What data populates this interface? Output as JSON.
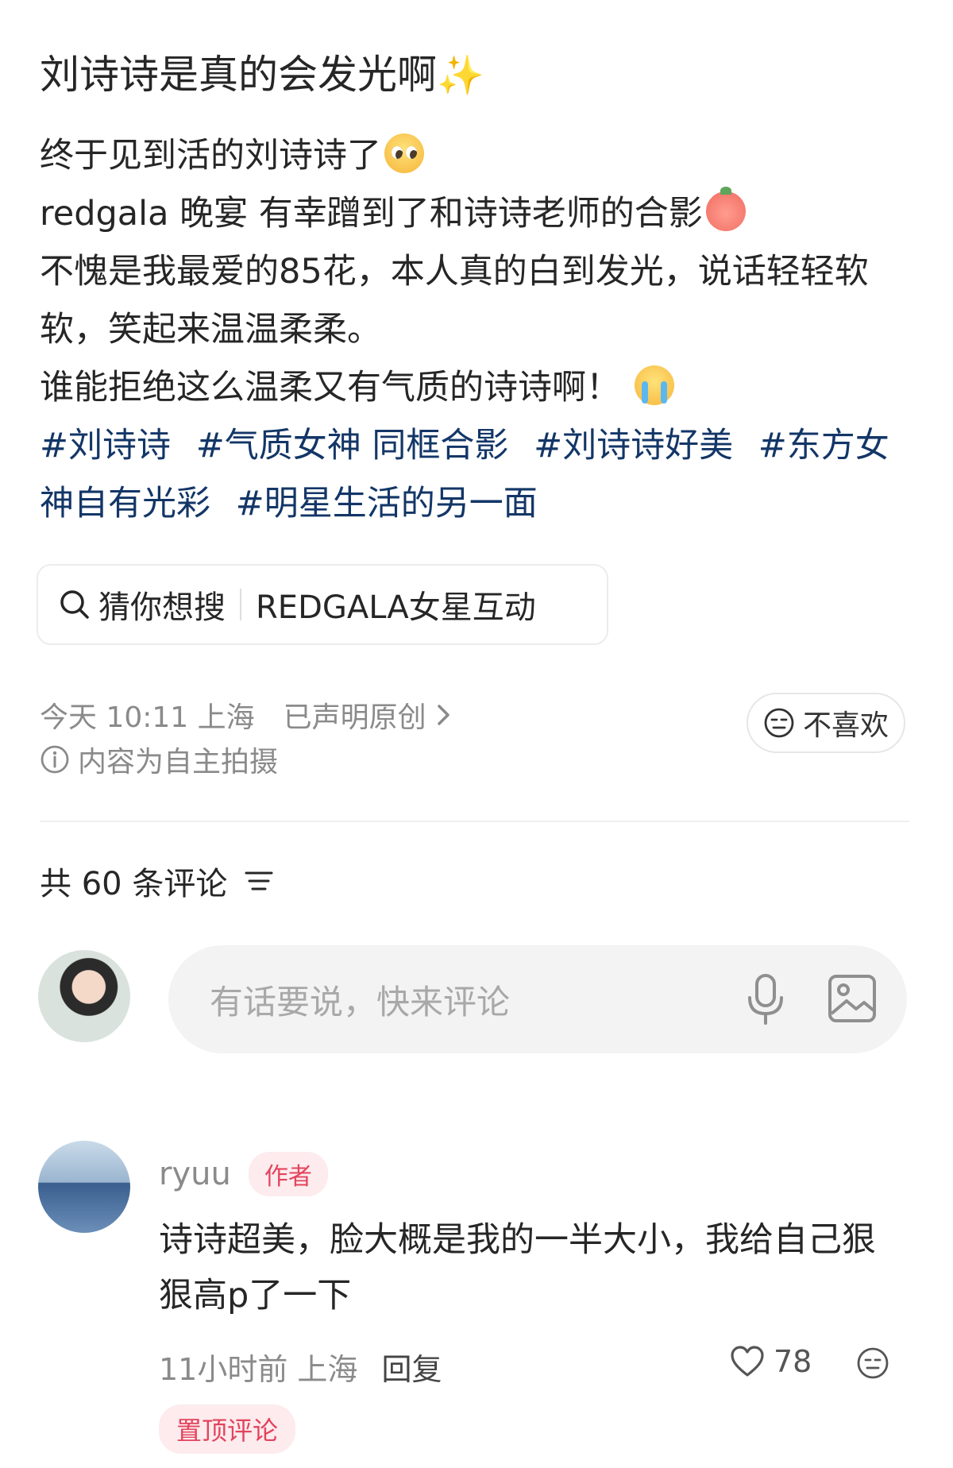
{
  "post": {
    "title": "刘诗诗是真的会发光啊",
    "body_lines": [
      "终于见到活的刘诗诗了",
      "redgala 晚宴 有幸蹭到了和诗诗老师的合影",
      "不愧是我最爱的85花，本人真的白到发光，说话轻轻软软，笑起来温温柔柔。",
      "谁能拒绝这么温柔又有气质的诗诗啊！"
    ],
    "tags": [
      "#刘诗诗",
      "#气质女神 同框合影",
      "#刘诗诗好美",
      "#东方女神自有光彩",
      "#明星生活的另一面"
    ],
    "emojis": [
      "sparkles-emoji",
      "pleading-emoji",
      "peach-emoji",
      "crying-emoji"
    ]
  },
  "search_suggest": {
    "label": "猜你想搜",
    "query": "REDGALA女星互动"
  },
  "meta": {
    "time": "今天 10:11 上海",
    "original": "已声明原创",
    "notice": "内容为自主拍摄",
    "dislike": "不喜欢"
  },
  "comments": {
    "count_label": "共 60 条评论",
    "input_placeholder": "有话要说，快来评论",
    "items": [
      {
        "user": "ryuu",
        "badge": "作者",
        "text": "诗诗超美，脸大概是我的一半大小，我给自己狠狠高p了一下",
        "time": "11小时前 上海",
        "reply": "回复",
        "likes": "78",
        "pinned": "置顶评论"
      }
    ]
  },
  "colors": {
    "tag": "#133667",
    "badge_text": "#e2445c",
    "badge_bg": "#fdebee",
    "muted": "#8a8a8a"
  }
}
